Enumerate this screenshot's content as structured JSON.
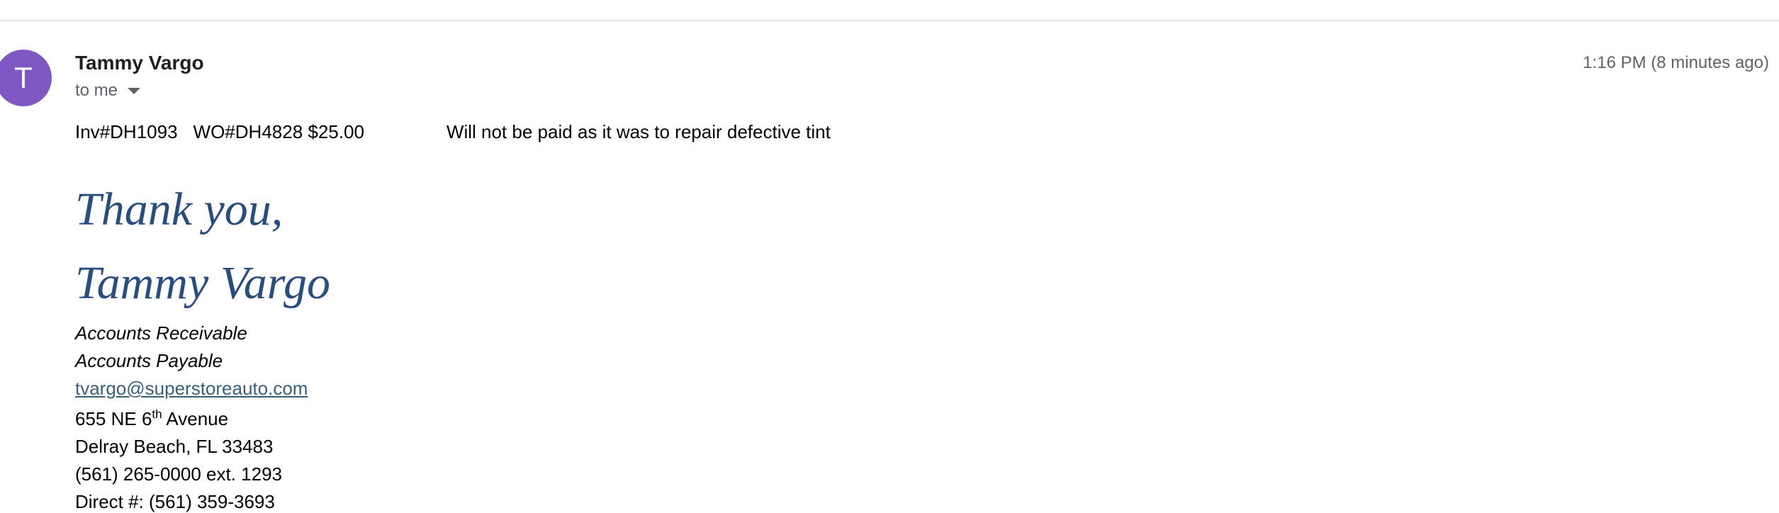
{
  "message": {
    "sender": {
      "initial": "T",
      "name": "Tammy Vargo",
      "avatar_color": "#7e57c2"
    },
    "recipient_label": "to me",
    "timestamp": "1:16 PM (8 minutes ago)",
    "body": {
      "invoice": "Inv#DH1093",
      "work_order": "WO#DH4828 $25.00",
      "note": "Will not be paid as it was to repair defective tint"
    },
    "signature": {
      "closing": "Thank you,",
      "name": "Tammy Vargo",
      "role_1": "Accounts Receivable",
      "role_2": "Accounts Payable",
      "email": "tvargo@superstoreauto.com",
      "address_prefix": "655 NE 6",
      "address_sup": "th",
      "address_suffix": " Avenue",
      "city_line": "Delray Beach, FL 33483",
      "phone": "(561) 265-0000 ext. 1293",
      "direct": "Direct #: (561) 359-3693",
      "accent_color": "#2a4d7f"
    }
  }
}
